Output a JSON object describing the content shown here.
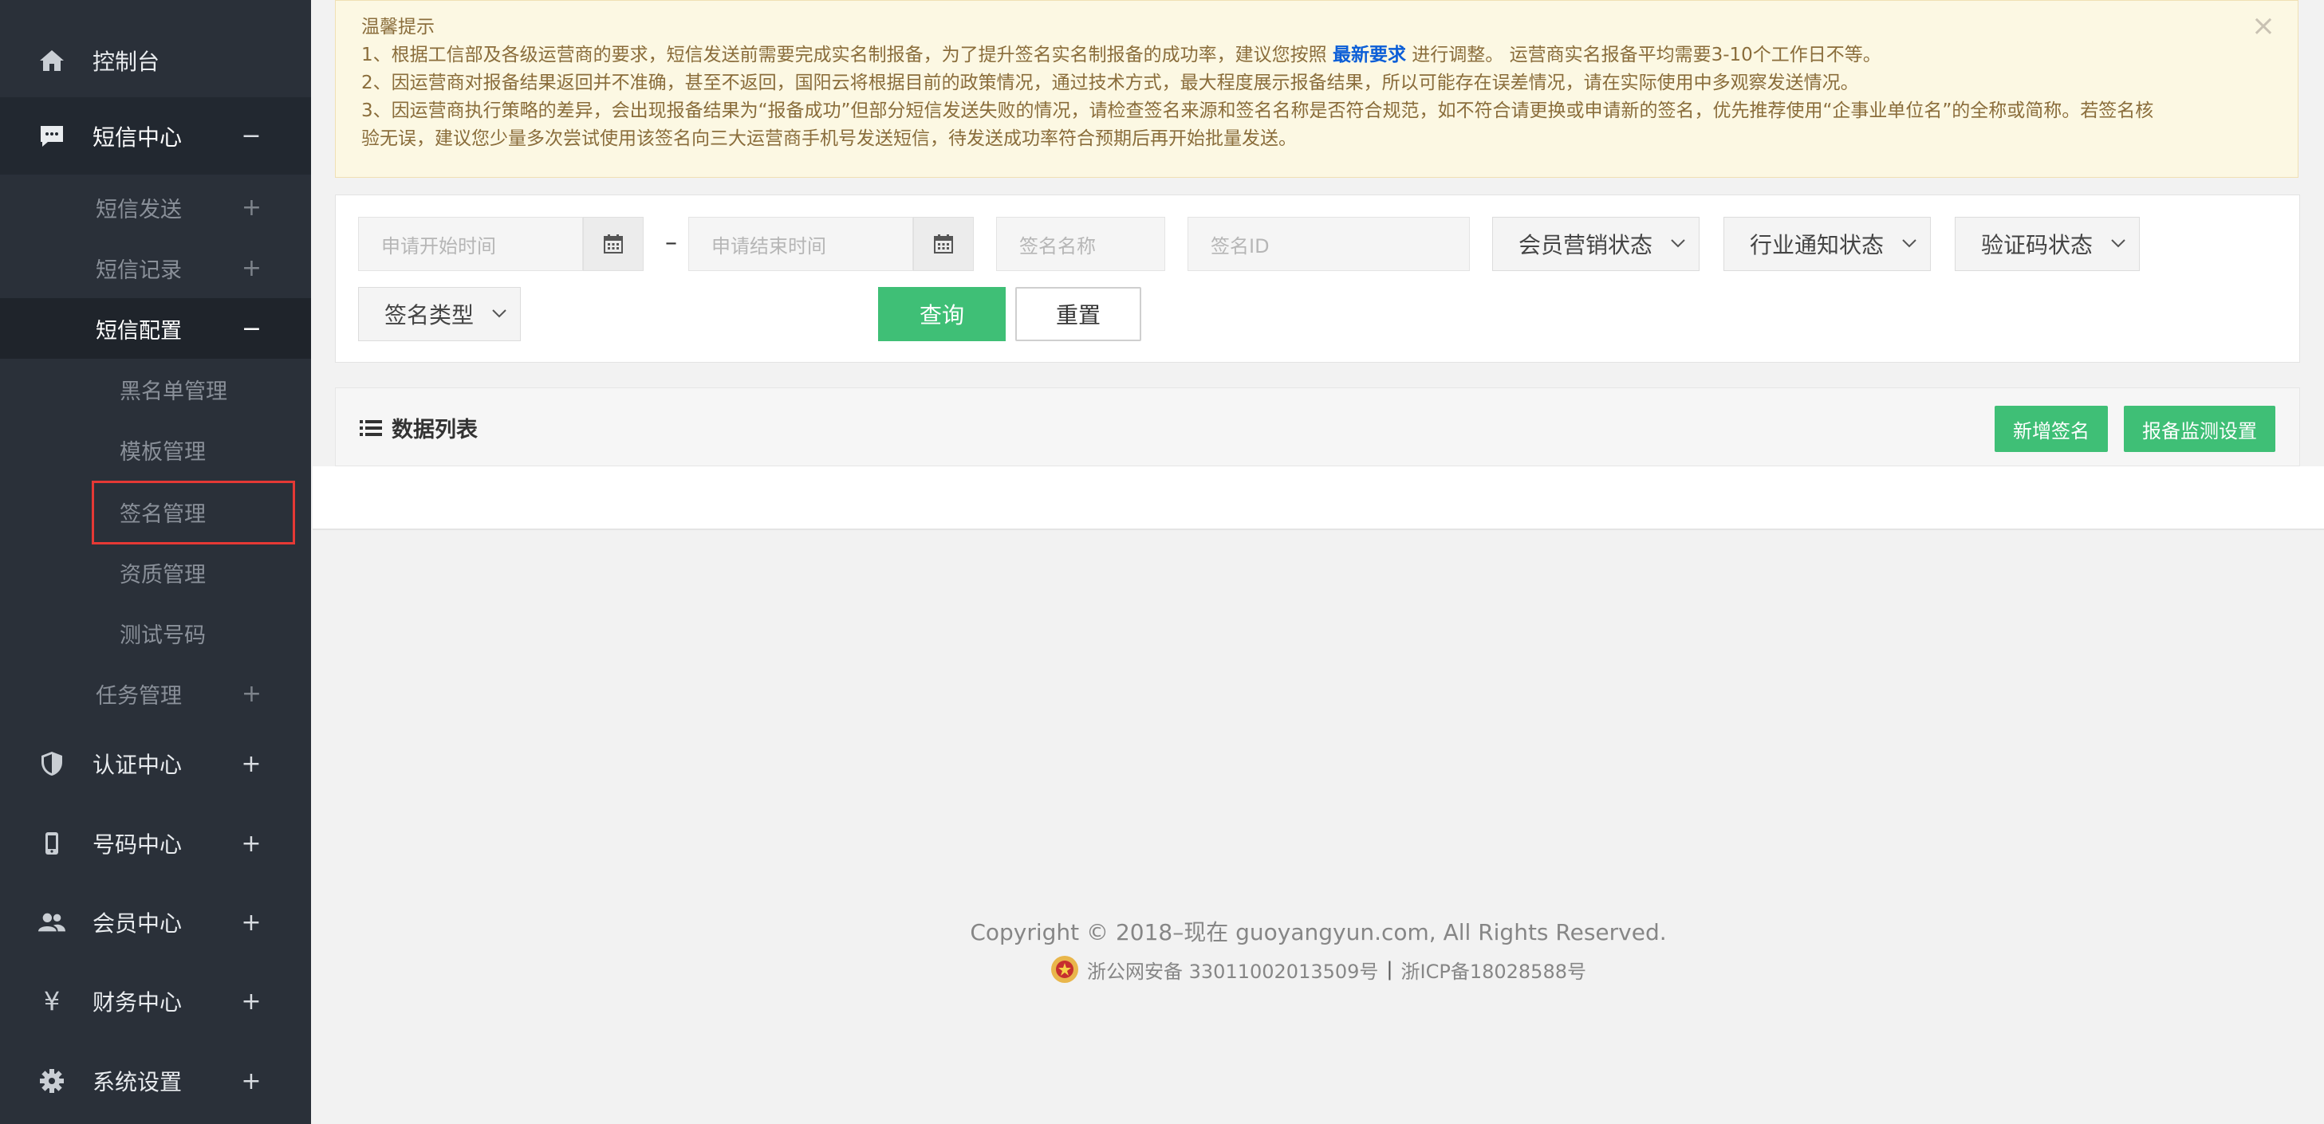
{
  "sidebar": {
    "items": [
      {
        "label": "控制台",
        "icon": "home-icon"
      },
      {
        "label": "短信中心",
        "icon": "message-icon",
        "toggle": "−"
      },
      {
        "label": "认证中心",
        "icon": "shield-icon",
        "toggle": "+"
      },
      {
        "label": "号码中心",
        "icon": "phone-icon",
        "toggle": "+"
      },
      {
        "label": "会员中心",
        "icon": "users-icon",
        "toggle": "+"
      },
      {
        "label": "财务中心",
        "icon": "yen-icon",
        "toggle": "+"
      },
      {
        "label": "系统设置",
        "icon": "gear-icon",
        "toggle": "+"
      }
    ],
    "sms_sub": [
      {
        "label": "短信发送",
        "toggle": "+"
      },
      {
        "label": "短信记录",
        "toggle": "+"
      },
      {
        "label": "短信配置",
        "toggle": "−"
      },
      {
        "label": "任务管理",
        "toggle": "+"
      }
    ],
    "config_leaves": [
      {
        "label": "黑名单管理"
      },
      {
        "label": "模板管理"
      },
      {
        "label": "签名管理"
      },
      {
        "label": "资质管理"
      },
      {
        "label": "测试号码"
      }
    ]
  },
  "notice": {
    "title": "温馨提示",
    "line1_before": "1、根据工信部及各级运营商的要求，短信发送前需要完成实名制报备，为了提升签名实名制报备的成功率，建议您按照 ",
    "line1_link": "最新要求",
    "line1_after": " 进行调整。 运营商实名报备平均需要3-10个工作日不等。",
    "line2": "2、因运营商对报备结果返回并不准确，甚至不返回，国阳云将根据目前的政策情况，通过技术方式，最大程度展示报备结果，所以可能存在误差情况，请在实际使用中多观察发送情况。",
    "line3a": "3、因运营商执行策略的差异，会出现报备结果为“报备成功”但部分短信发送失败的情况，请检查签名来源和签名名称是否符合规范，如不符合请更换或申请新的签名，优先推荐使用“企事业单位名”的全称或简称。若签名核",
    "line3b": "验无误，建议您少量多次尝试使用该签名向三大运营商手机号发送短信，待发送成功率符合预期后再开始批量发送。",
    "close": "×"
  },
  "filters": {
    "start_placeholder": "申请开始时间",
    "end_placeholder": "申请结束时间",
    "dash": "–",
    "sign_name_placeholder": "签名名称",
    "sign_id_placeholder": "签名ID",
    "member_status": "会员营销状态",
    "industry_status": "行业通知状态",
    "code_status": "验证码状态",
    "sign_type": "签名类型",
    "query": "查询",
    "reset": "重置"
  },
  "list": {
    "title": "数据列表",
    "add_sign": "新增签名",
    "monitor_settings": "报备监测设置"
  },
  "footer": {
    "copyright": "Copyright © 2018–现在 guoyangyun.com, All Rights Reserved.",
    "police": "浙公网安备 33011002013509号",
    "sep": "|",
    "icp": "浙ICP备18028588号"
  }
}
